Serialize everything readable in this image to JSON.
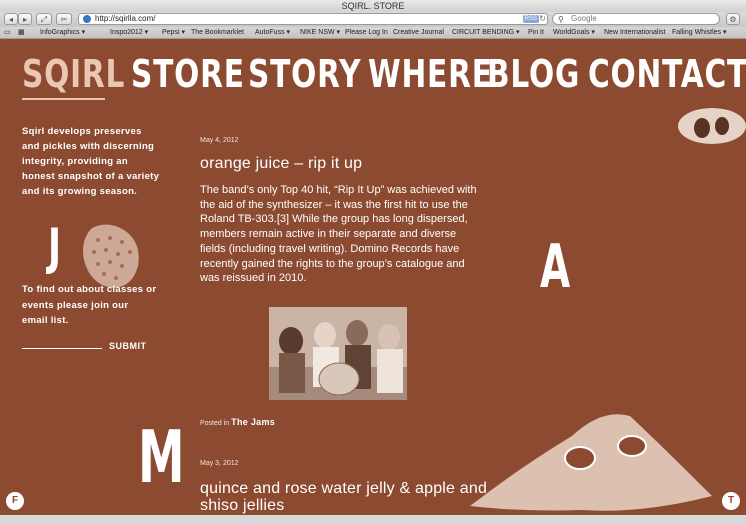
{
  "window": {
    "title": "SQIRL. STORE"
  },
  "toolbar": {
    "back_icon": "back-arrow-icon",
    "forward_icon": "forward-arrow-icon",
    "url": "http://sqirlla.com/",
    "rss_label": "RSS",
    "search_placeholder": "Google"
  },
  "bookmarks": [
    "InfoGraphics ▾",
    "Inspo2012 ▾",
    "Pepsi ▾",
    "The Bookmarklet",
    "AutoFuss ▾",
    "NIKE NSW ▾",
    "Please Log In",
    "Creative Journal",
    "CIRCUIT BENDING ▾",
    "Pin It",
    "WorldGoals ▾",
    "New Internationalist",
    "Falling Whistles ▾"
  ],
  "nav": {
    "items": [
      "SQIRL",
      "STORE",
      "STORY",
      "WHERE",
      "BLOG",
      "CONTACT"
    ]
  },
  "sidebar": {
    "intro": "Sqirl develops preserves and pickles with discerning integrity, providing an honest snapshot of a variety and its growing season.",
    "letter_j": "J",
    "email_prompt": "To find out about classes or events please join our email list.",
    "submit": "SUBMIT",
    "letter_m": "M"
  },
  "letter_a": "A",
  "posts": [
    {
      "date": "May 4, 2012",
      "title": "orange juice – rip it up",
      "body": "The band’s only Top 40 hit, “Rip It Up” was achieved with the aid of the synthesizer – it was the first hit to use the Roland TB-303.[3] While the group has long dispersed, members remain active in their separate and diverse fields (including travel writing). Domino Records have recently gained the rights to the group’s catalogue and was reissued in 2010.",
      "posted_in_label": "Posted in",
      "category": "The Jams"
    },
    {
      "date": "May 3, 2012",
      "title": "quince and rose water jelly & apple and shiso jellies"
    }
  ],
  "badges": {
    "left": "F",
    "right": "T"
  },
  "colors": {
    "background": "#8c4a31",
    "accent": "#e9c7b2",
    "text": "#ffffff"
  }
}
